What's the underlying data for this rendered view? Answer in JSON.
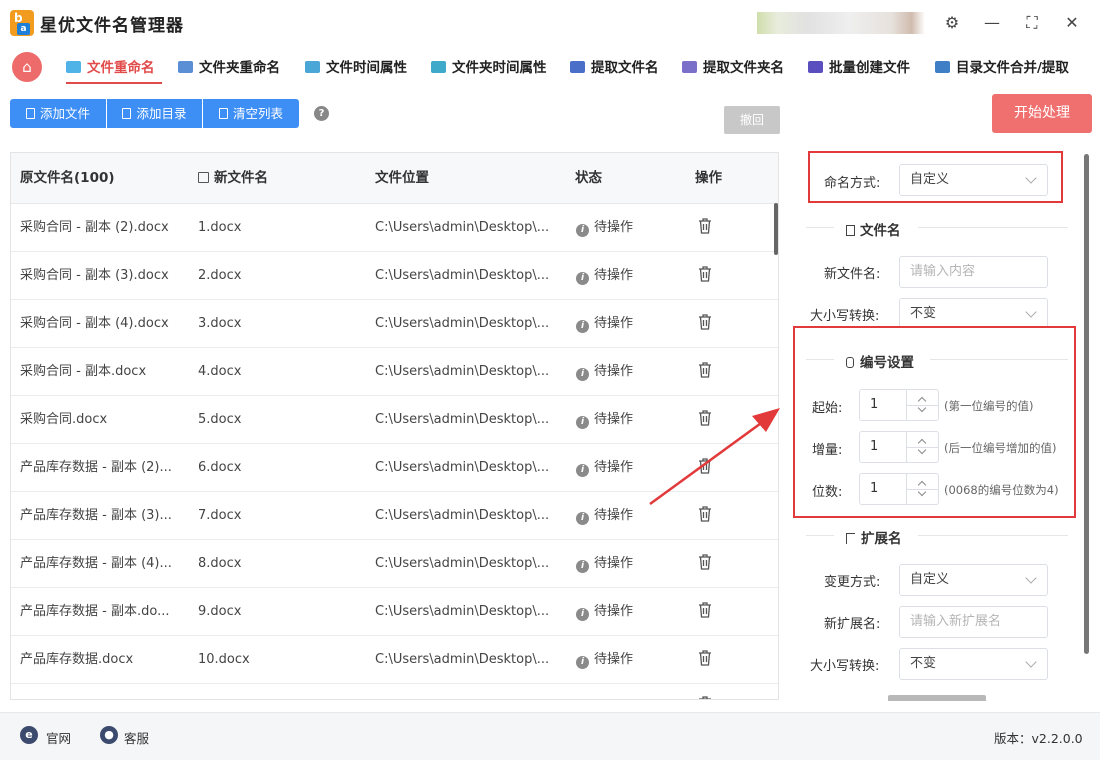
{
  "app": {
    "title": "星优文件名管理器",
    "logo_top": "b",
    "logo_bottom": "a"
  },
  "window": {
    "settings": "⚙",
    "minimize": "—",
    "maximize": "⛶",
    "close": "✕"
  },
  "nav": {
    "home_glyph": "⌂",
    "tabs": [
      {
        "label": "文件重命名",
        "active": true,
        "icon_color": "#4fb3e8"
      },
      {
        "label": "文件夹重命名",
        "active": false,
        "icon_color": "#5a8fd6"
      },
      {
        "label": "文件时间属性",
        "active": false,
        "icon_color": "#4aa6d6"
      },
      {
        "label": "文件夹时间属性",
        "active": false,
        "icon_color": "#3fa9c9"
      },
      {
        "label": "提取文件名",
        "active": false,
        "icon_color": "#4a6fc9"
      },
      {
        "label": "提取文件夹名",
        "active": false,
        "icon_color": "#7a6fc9"
      },
      {
        "label": "批量创建文件",
        "active": false,
        "icon_color": "#5b4fbf"
      },
      {
        "label": "目录文件合并/提取",
        "active": false,
        "icon_color": "#3f7fc6"
      }
    ]
  },
  "toolbar": {
    "add_file": "添加文件",
    "add_dir": "添加目录",
    "clear": "清空列表",
    "help": "?",
    "undo": "撤回",
    "start": "开始处理"
  },
  "table": {
    "columns": {
      "original": "原文件名(100)",
      "new": "新文件名",
      "location": "文件位置",
      "status": "状态",
      "action": "操作"
    },
    "rows": [
      {
        "original": "采购合同 - 副本 (2).docx",
        "new": "1.docx",
        "location": "C:\\Users\\admin\\Desktop\\...",
        "status": "待操作"
      },
      {
        "original": "采购合同 - 副本 (3).docx",
        "new": "2.docx",
        "location": "C:\\Users\\admin\\Desktop\\...",
        "status": "待操作"
      },
      {
        "original": "采购合同 - 副本 (4).docx",
        "new": "3.docx",
        "location": "C:\\Users\\admin\\Desktop\\...",
        "status": "待操作"
      },
      {
        "original": "采购合同 - 副本.docx",
        "new": "4.docx",
        "location": "C:\\Users\\admin\\Desktop\\...",
        "status": "待操作"
      },
      {
        "original": "采购合同.docx",
        "new": "5.docx",
        "location": "C:\\Users\\admin\\Desktop\\...",
        "status": "待操作"
      },
      {
        "original": "产品库存数据 - 副本 (2)...",
        "new": "6.docx",
        "location": "C:\\Users\\admin\\Desktop\\...",
        "status": "待操作"
      },
      {
        "original": "产品库存数据 - 副本 (3)...",
        "new": "7.docx",
        "location": "C:\\Users\\admin\\Desktop\\...",
        "status": "待操作"
      },
      {
        "original": "产品库存数据 - 副本 (4)...",
        "new": "8.docx",
        "location": "C:\\Users\\admin\\Desktop\\...",
        "status": "待操作"
      },
      {
        "original": "产品库存数据 - 副本.do...",
        "new": "9.docx",
        "location": "C:\\Users\\admin\\Desktop\\...",
        "status": "待操作"
      },
      {
        "original": "产品库存数据.docx",
        "new": "10.docx",
        "location": "C:\\Users\\admin\\Desktop\\...",
        "status": "待操作"
      }
    ]
  },
  "panel": {
    "naming_mode": {
      "label": "命名方式:",
      "value": "自定义"
    },
    "filename_section": {
      "title": "文件名",
      "new_name_label": "新文件名:",
      "new_name_placeholder": "请输入内容",
      "case_label": "大小写转换:",
      "case_value": "不变"
    },
    "number_section": {
      "title": "编号设置",
      "start": {
        "label": "起始:",
        "value": "1",
        "hint": "(第一位编号的值)"
      },
      "step": {
        "label": "增量:",
        "value": "1",
        "hint": "(后一位编号增加的值)"
      },
      "digits": {
        "label": "位数:",
        "value": "1",
        "hint": "(0068的编号位数为4)"
      }
    },
    "ext_section": {
      "title": "扩展名",
      "mode_label": "变更方式:",
      "mode_value": "自定义",
      "new_ext_label": "新扩展名:",
      "new_ext_placeholder": "请输入新扩展名",
      "case_label": "大小写转换:",
      "case_value": "不变"
    }
  },
  "footer": {
    "website": "官网",
    "support": "客服",
    "version": "版本：v2.2.0.0"
  },
  "colors": {
    "accent_red": "#e24b4b",
    "primary_blue": "#3d8ef5",
    "start_button": "#f07070",
    "annotation_red": "#e23a3a"
  }
}
